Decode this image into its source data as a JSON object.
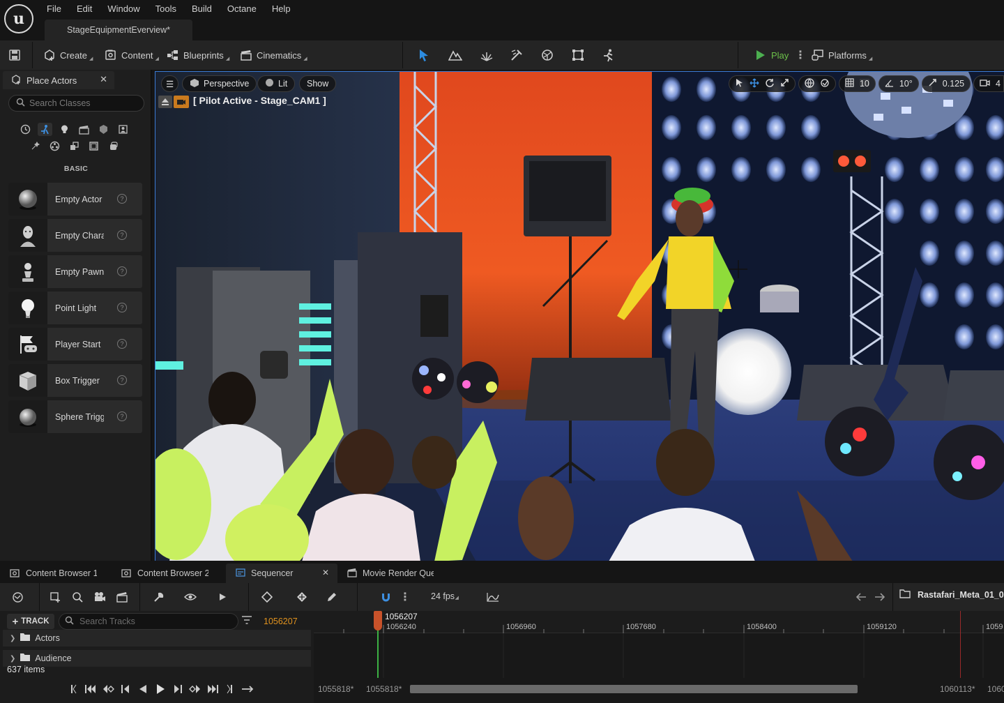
{
  "app": {
    "menus": [
      "File",
      "Edit",
      "Window",
      "Tools",
      "Build",
      "Octane",
      "Help"
    ],
    "document_tab": "StageEquipmentEverview*"
  },
  "toolbar": {
    "create": "Create",
    "content": "Content",
    "blueprints": "Blueprints",
    "cinematics": "Cinematics",
    "play": "Play",
    "platforms": "Platforms"
  },
  "place_actors": {
    "tab_title": "Place Actors",
    "search_placeholder": "Search Classes",
    "category": "BASIC",
    "items": [
      {
        "label": "Empty Actor",
        "icon": "sphere-icon"
      },
      {
        "label": "Empty Character",
        "icon": "character-icon"
      },
      {
        "label": "Empty Pawn",
        "icon": "pawn-icon"
      },
      {
        "label": "Point Light",
        "icon": "light-bulb-icon"
      },
      {
        "label": "Player Start",
        "icon": "gamepad-flag-icon"
      },
      {
        "label": "Box Trigger",
        "icon": "cube-icon"
      },
      {
        "label": "Sphere Trigger",
        "icon": "sphere-icon"
      }
    ]
  },
  "viewport": {
    "view_mode": "Perspective",
    "lighting": "Lit",
    "show": "Show",
    "pilot_label": "[ Pilot Active - Stage_CAM1 ]",
    "grid_snap": "10",
    "rotation_snap": "10°",
    "scale_snap": "0.125",
    "camera_speed": "4"
  },
  "bottom_tabs": [
    "Content Browser 1",
    "Content Browser 2",
    "Sequencer",
    "Movie Render Queue"
  ],
  "sequencer": {
    "fps": "24 fps",
    "sequence_name": "Rastafari_Meta_01_0",
    "add_track": "TRACK",
    "search_placeholder": "Search Tracks",
    "current_frame": "1056207",
    "tracks": [
      "Actors",
      "Audience"
    ],
    "item_count": "637 items",
    "ruler_ticks": [
      "1056240",
      "1056960",
      "1057680",
      "1058400",
      "1059120",
      "1059"
    ],
    "playhead_frame": "1056207",
    "range_start_outer": "1055818*",
    "range_start": "1055818*",
    "range_end": "1060113*",
    "range_end_outer": "1060"
  }
}
